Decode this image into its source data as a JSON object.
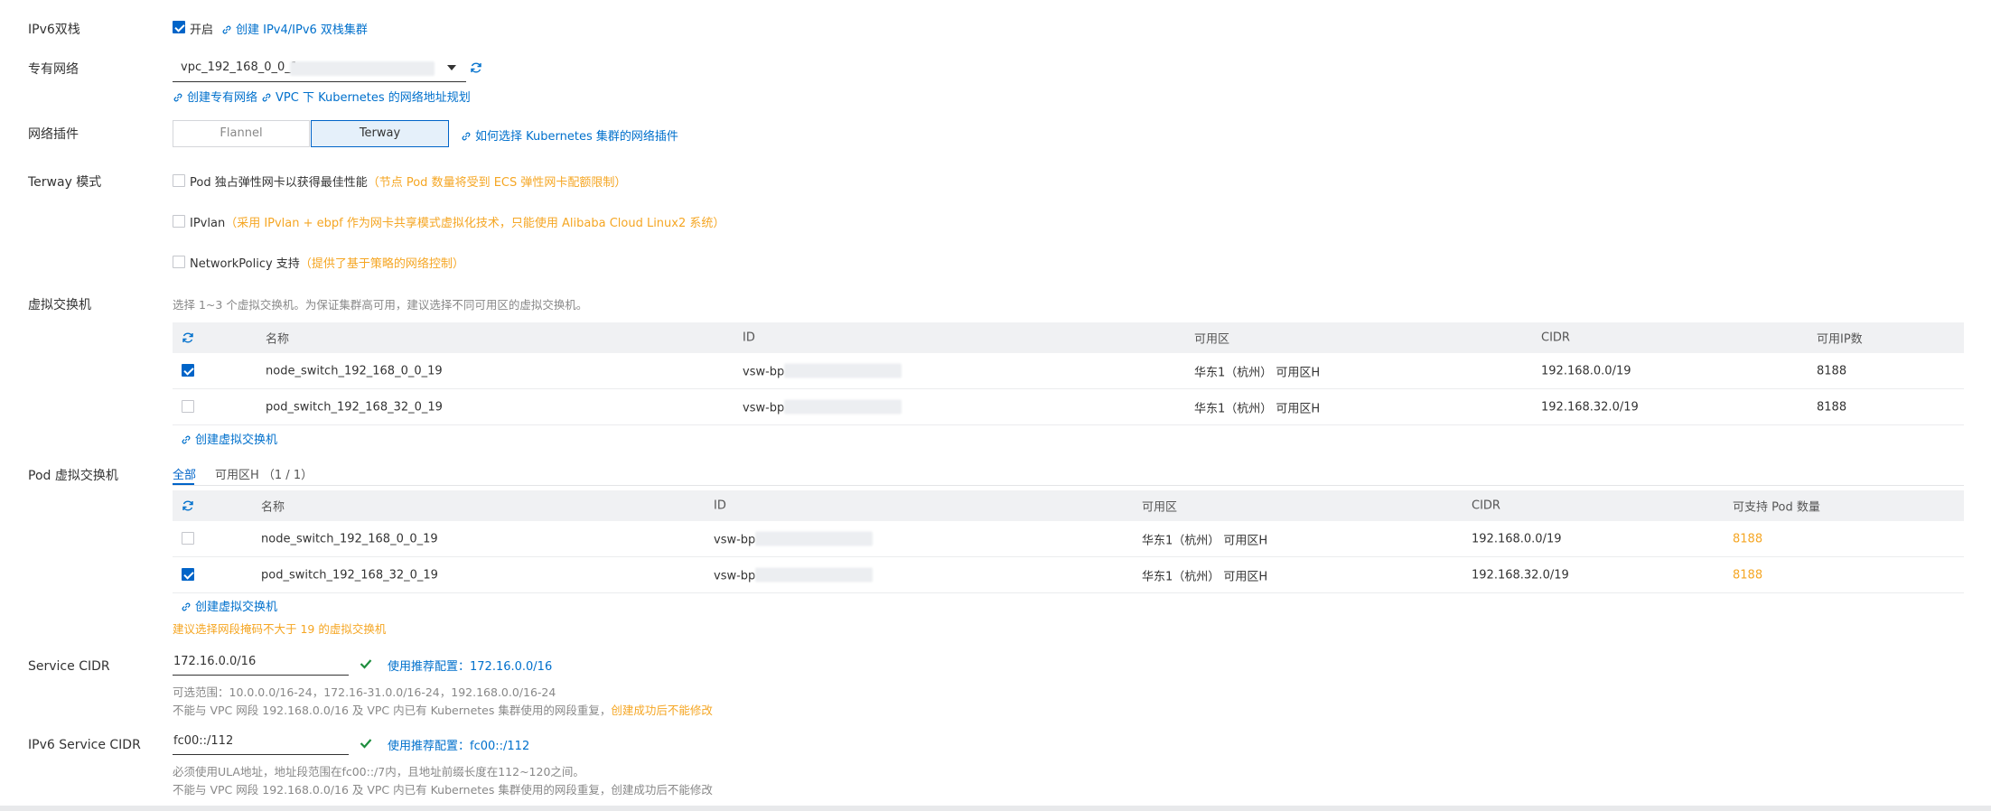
{
  "ipv6": {
    "label": "IPv6双栈",
    "checkbox_label": "开启",
    "link": "创建 IPv4/IPv6 双栈集群"
  },
  "vpc": {
    "label": "专有网络",
    "selected": "vpc_192_168_0_0_1",
    "links": [
      "创建专有网络",
      "VPC 下 Kubernetes 的网络地址规划"
    ]
  },
  "plugin": {
    "label": "网络插件",
    "options": [
      "Flannel",
      "Terway"
    ],
    "selected": "Terway",
    "link": "如何选择 Kubernetes 集群的网络插件"
  },
  "terway_mode": {
    "label": "Terway 模式",
    "options": [
      {
        "text": "Pod 独占弹性网卡以获得最佳性能",
        "note": "（节点 Pod 数量将受到 ECS 弹性网卡配额限制）"
      },
      {
        "text": "IPvlan",
        "note": "（采用 IPvlan + ebpf 作为网卡共享模式虚拟化技术，只能使用 Alibaba Cloud Linux2 系统）"
      },
      {
        "text": "NetworkPolicy 支持",
        "note": "（提供了基于策略的网络控制）"
      }
    ]
  },
  "vswitch": {
    "label": "虚拟交换机",
    "hint": "选择 1~3 个虚拟交换机。为保证集群高可用，建议选择不同可用区的虚拟交换机。",
    "columns": [
      "名称",
      "ID",
      "可用区",
      "CIDR",
      "可用IP数"
    ],
    "rows": [
      {
        "name": "node_switch_192_168_0_0_19",
        "id": "vsw-bp",
        "zone": "华东1（杭州） 可用区H",
        "cidr": "192.168.0.0/19",
        "count": "8188",
        "checked": true
      },
      {
        "name": "pod_switch_192_168_32_0_19",
        "id": "vsw-bp",
        "zone": "华东1（杭州） 可用区H",
        "cidr": "192.168.32.0/19",
        "count": "8188",
        "checked": false
      }
    ],
    "create_link": "创建虚拟交换机"
  },
  "pod_vswitch": {
    "label": "Pod 虚拟交换机",
    "tabs": [
      "全部",
      "可用区H （1 / 1）"
    ],
    "columns": [
      "名称",
      "ID",
      "可用区",
      "CIDR",
      "可支持 Pod 数量"
    ],
    "rows": [
      {
        "name": "node_switch_192_168_0_0_19",
        "id": "vsw-bp",
        "zone": "华东1（杭州） 可用区H",
        "cidr": "192.168.0.0/19",
        "count": "8188",
        "checked": false
      },
      {
        "name": "pod_switch_192_168_32_0_19",
        "id": "vsw-bp",
        "zone": "华东1（杭州） 可用区H",
        "cidr": "192.168.32.0/19",
        "count": "8188",
        "checked": true
      }
    ],
    "create_link": "创建虚拟交换机",
    "warning": "建议选择网段掩码不大于 19 的虚拟交换机"
  },
  "service_cidr": {
    "label": "Service CIDR",
    "value": "172.16.0.0/16",
    "recommend": "使用推荐配置：172.16.0.0/16",
    "hint1": "可选范围：10.0.0.0/16-24，172.16-31.0.0/16-24，192.168.0.0/16-24",
    "hint2": "不能与 VPC 网段 192.168.0.0/16 及 VPC 内已有 Kubernetes 集群使用的网段重复，",
    "hint2_warn": "创建成功后不能修改"
  },
  "ipv6_service_cidr": {
    "label": "IPv6 Service CIDR",
    "value": "fc00::/112",
    "recommend": "使用推荐配置：fc00::/112",
    "hint1": "必须使用ULA地址，地址段范围在fc00::/7内，且地址前缀长度在112~120之间。",
    "hint2": "不能与 VPC 网段 192.168.0.0/16 及 VPC 内已有 Kubernetes 集群使用的网段重复，创建成功后不能修改"
  },
  "colors": {
    "primary": "#0064c8",
    "link": "#0070cc",
    "warning": "#f5a623",
    "success": "#1e8e3e"
  }
}
